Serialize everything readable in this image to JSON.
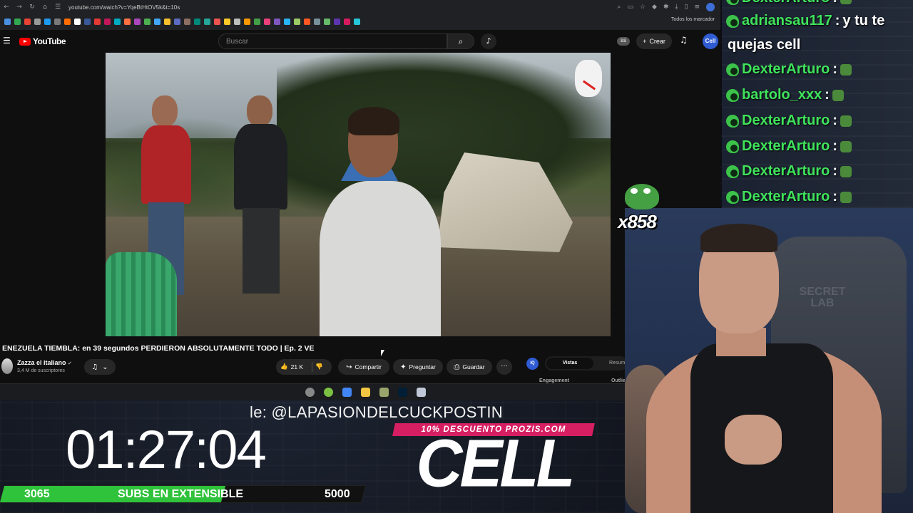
{
  "browser": {
    "url": "youtube.com/watch?v=YqeBtHtOV5k&t=10s",
    "bookmarks_all_label": "Todos los marcador",
    "bookmark_colors": [
      "#4a90e2",
      "#33a853",
      "#ea4335",
      "#999999",
      "#1d9bf0",
      "#7a7a7a",
      "#ff6d00",
      "#ffffff",
      "#3b5998",
      "#e53935",
      "#c2185b",
      "#00acc1",
      "#ff7043",
      "#ab47bc",
      "#4caf50",
      "#42a5f5",
      "#fbc02d",
      "#5c6bc0",
      "#8d6e63",
      "#00897b",
      "#26a69a",
      "#ef5350",
      "#ffca28",
      "#bdbdbd",
      "#ff9800",
      "#43a047",
      "#ec407a",
      "#7e57c2",
      "#29b6f6",
      "#9ccc65",
      "#ff5722",
      "#78909c",
      "#66bb6a",
      "#5e35b1",
      "#d81b60",
      "#26c6da"
    ]
  },
  "youtube": {
    "logo_text": "YouTube",
    "search_placeholder": "Buscar",
    "ss_badge": "SS",
    "create_label": "Crear",
    "avatar_text": "Cell",
    "video_title": "ENEZUELA TIEMBLA: en 39 segundos PERDIERON ABSOLUTAMENTE TODO | Ep. 2 VE",
    "channel_name": "Zazza el italiano",
    "channel_subs": "3,4 M de suscriptores",
    "likes": "21 K",
    "share_label": "Compartir",
    "ask_label": "Preguntar",
    "save_label": "Guardar",
    "more_label": "···",
    "side_logo": "IQ",
    "side_tab_active": "Vistas",
    "side_tab_other": "Resum",
    "side_engagement": "Engagement",
    "side_outlier": "Outlie"
  },
  "taskbar": {
    "app_colors": [
      "#888888",
      "#7cc142",
      "#4285f4",
      "#f4c542",
      "#9aa36b",
      "#001e36",
      "#c0c7d6"
    ]
  },
  "overlay": {
    "ticker": "le: @LAPASIONDELCUCKPOSTIN",
    "promo": "10% DESCUENTO PROZIS.COM",
    "brand": "CELL",
    "timer": "01:27:04",
    "subs_current": "3065",
    "subs_label": "SUBS EN EXTENSIBLE",
    "subs_goal": "5000",
    "subs_progress": 0.613,
    "combo": "x858"
  },
  "chat": {
    "accent": "#3fe35b",
    "messages": [
      {
        "user": "DexterArturo",
        "text": ""
      },
      {
        "user": "adriansau117",
        "text": "y tu te"
      },
      {
        "user": "DexterArturo",
        "text": ""
      },
      {
        "user": "bartolo_xxx",
        "text": ""
      },
      {
        "user": "DexterArturo",
        "text": ""
      },
      {
        "user": "DexterArturo",
        "text": ""
      },
      {
        "user": "DexterArturo",
        "text": ""
      },
      {
        "user": "DexterArturo",
        "text": ""
      }
    ],
    "continuation": "quejas cell"
  },
  "webcam": {
    "chair_brand": "SECRET LAB"
  }
}
